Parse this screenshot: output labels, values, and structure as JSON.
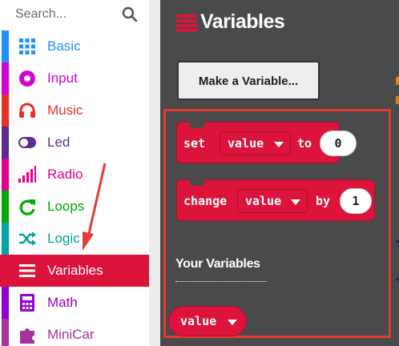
{
  "search": {
    "placeholder": "Search..."
  },
  "categories": [
    {
      "label": "Basic",
      "color": "#1e90ff",
      "icon": "grid-icon"
    },
    {
      "label": "Input",
      "color": "#d400d4",
      "icon": "circle-target-icon"
    },
    {
      "label": "Music",
      "color": "#e63022",
      "icon": "headphones-icon"
    },
    {
      "label": "Led",
      "color": "#5c2d91",
      "icon": "toggle-icon"
    },
    {
      "label": "Radio",
      "color": "#e3008c",
      "icon": "signal-bars-icon"
    },
    {
      "label": "Loops",
      "color": "#00aa00",
      "icon": "refresh-icon"
    },
    {
      "label": "Logic",
      "color": "#00a4a6",
      "icon": "shuffle-icon"
    },
    {
      "label": "Variables",
      "color": "#dc143c",
      "icon": "list-icon"
    },
    {
      "label": "Math",
      "color": "#9400d3",
      "icon": "calculator-icon"
    },
    {
      "label": "MiniCar",
      "color": "#a8329c",
      "icon": "puzzle-icon"
    }
  ],
  "selected_category": "Variables",
  "flyout": {
    "title": "Variables",
    "make_variable_label": "Make a Variable...",
    "set_block": {
      "keyword": "set",
      "variable": "value",
      "connector": "to",
      "number": "0"
    },
    "change_block": {
      "keyword": "change",
      "variable": "value",
      "connector": "by",
      "number": "1"
    },
    "your_variables_label": "Your Variables",
    "variable_reporter": "value"
  },
  "colors": {
    "variables_block": "#dc143c",
    "flyout_background": "#4a4a4a",
    "highlight_frame": "#e53935",
    "annotation_arrow": "#e53935"
  }
}
